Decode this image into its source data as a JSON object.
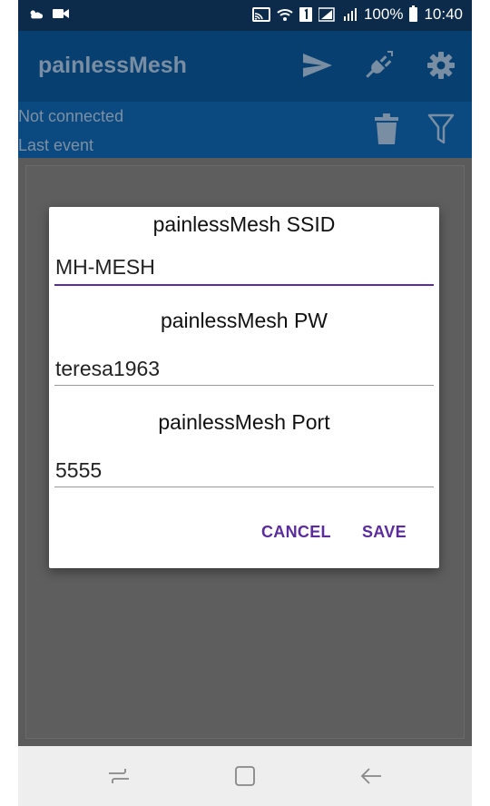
{
  "status_bar": {
    "battery_percent": "100%",
    "time": "10:40"
  },
  "app_bar": {
    "title": "painlessMesh"
  },
  "sub_bar": {
    "connection_status": "Not connected",
    "last_event": "Last event"
  },
  "dialog": {
    "ssid": {
      "label": "painlessMesh SSID",
      "value": "MH-MESH"
    },
    "password": {
      "label": "painlessMesh PW",
      "value": "teresa1963"
    },
    "port": {
      "label": "painlessMesh Port",
      "value": "5555"
    },
    "cancel_label": "CANCEL",
    "save_label": "SAVE"
  },
  "colors": {
    "status_bar": "#0c2a4a",
    "app_bar": "#063f70",
    "accent": "#5b2c9e"
  },
  "icons": {
    "app_bar": [
      "send-icon",
      "plug-icon",
      "gear-icon"
    ],
    "sub_bar": [
      "trash-icon",
      "filter-icon"
    ],
    "nav_bar": [
      "recents-icon",
      "home-icon",
      "back-icon"
    ]
  }
}
